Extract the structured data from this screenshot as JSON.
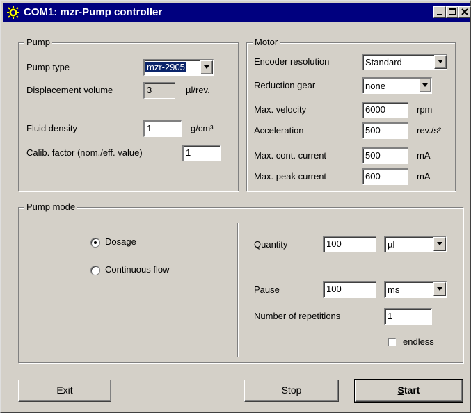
{
  "window": {
    "title": "COM1: mzr-Pump controller",
    "icon": "gear-icon"
  },
  "pump": {
    "group_title": "Pump",
    "type_label": "Pump type",
    "type_value": "mzr-2905",
    "displacement_label": "Displacement volume",
    "displacement_value": "3",
    "displacement_unit": "µl/rev.",
    "density_label": "Fluid density",
    "density_value": "1",
    "density_unit": "g/cm³",
    "calib_label": "Calib. factor (nom./eff. value)",
    "calib_value": "1"
  },
  "motor": {
    "group_title": "Motor",
    "encoder_label": "Encoder resolution",
    "encoder_value": "Standard",
    "gear_label": "Reduction gear",
    "gear_value": "none",
    "velocity_label": "Max. velocity",
    "velocity_value": "6000",
    "velocity_unit": "rpm",
    "accel_label": "Acceleration",
    "accel_value": "500",
    "accel_unit": "rev./s²",
    "cont_label": "Max. cont. current",
    "cont_value": "500",
    "cont_unit": "mA",
    "peak_label": "Max. peak current",
    "peak_value": "600",
    "peak_unit": "mA"
  },
  "mode": {
    "group_title": "Pump mode",
    "dosage_label": "Dosage",
    "dosage_selected": true,
    "continuous_label": "Continuous flow",
    "quantity_label": "Quantity",
    "quantity_value": "100",
    "quantity_unit": "µl",
    "pause_label": "Pause",
    "pause_value": "100",
    "pause_unit": "ms",
    "reps_label": "Number of repetitions",
    "reps_value": "1",
    "endless_label": "endless",
    "endless_checked": false
  },
  "buttons": {
    "exit": "Exit",
    "stop": "Stop",
    "start_accel": "S",
    "start_rest": "tart"
  }
}
